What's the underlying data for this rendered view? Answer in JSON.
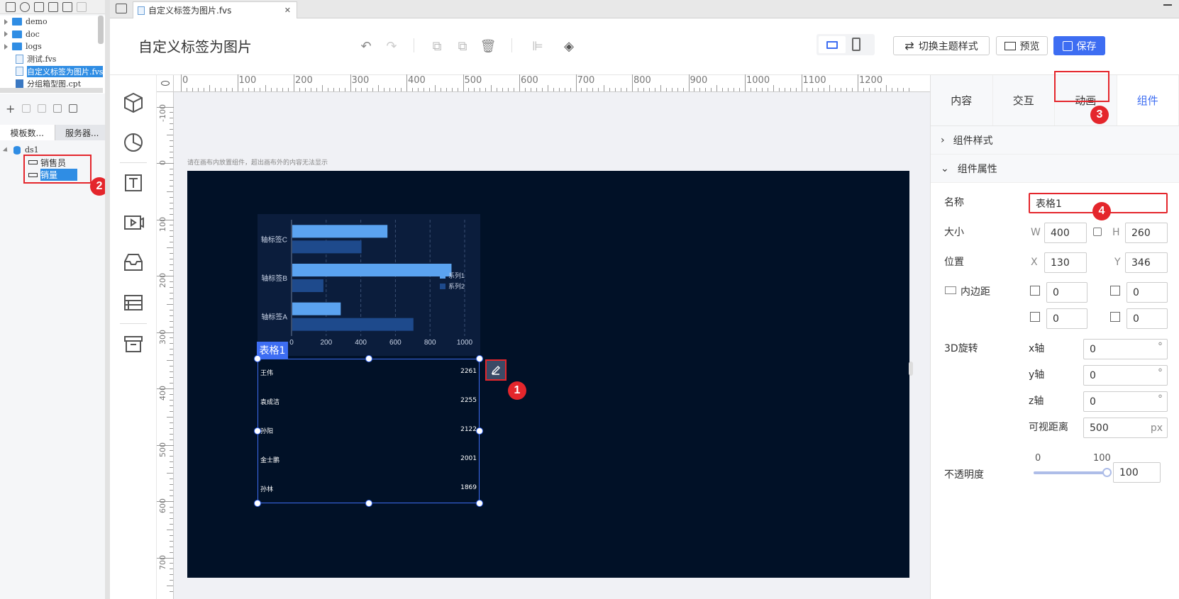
{
  "left_panel": {
    "tree": [
      "demo",
      "doc",
      "logs",
      "测试.fvs",
      "自定义标签为图片.fvs",
      "分组箱型图.cpt"
    ],
    "tabs": [
      "模板数...",
      "服务器..."
    ],
    "dataset": "ds1",
    "fields": [
      "销售员",
      "销量"
    ]
  },
  "tabbar": {
    "doc_tab": "自定义标签为图片.fvs",
    "close": "✕"
  },
  "header": {
    "title": "自定义标签为图片",
    "switch_theme": "切换主题样式",
    "preview": "预览",
    "save": "保存"
  },
  "ruler": {
    "top": [
      "0",
      "100",
      "200",
      "300",
      "400",
      "500",
      "600",
      "700",
      "800",
      "900",
      "1000",
      "1100",
      "1200"
    ],
    "left": [
      "-100",
      "0",
      "100",
      "200",
      "300",
      "400",
      "500",
      "600",
      "700"
    ]
  },
  "canvas": {
    "hint": "请在画布内放置组件，超出画布外的内容无法显示"
  },
  "chart_data": {
    "type": "bar",
    "categories": [
      "轴标签C",
      "轴标签B",
      "轴标签A"
    ],
    "series": [
      {
        "name": "系列1",
        "values": [
          550,
          920,
          280
        ]
      },
      {
        "name": "系列2",
        "values": [
          400,
          180,
          700
        ]
      }
    ],
    "xticks": [
      "0",
      "200",
      "400",
      "600",
      "800",
      "1000"
    ],
    "xlim": [
      0,
      1000
    ],
    "legend": "right"
  },
  "table_widget": {
    "label": "表格1",
    "rows": [
      {
        "name": "王伟",
        "value": "2261"
      },
      {
        "name": "袁成洁",
        "value": "2255"
      },
      {
        "name": "孙阳",
        "value": "2122"
      },
      {
        "name": "金士鹏",
        "value": "2001"
      },
      {
        "name": "孙林",
        "value": "1869"
      }
    ]
  },
  "right_panel": {
    "tabs": [
      "内容",
      "交互",
      "动画",
      "组件"
    ],
    "section_style": "组件样式",
    "section_props": "组件属性",
    "name_label": "名称",
    "name_value": "表格1",
    "size_label": "大小",
    "w_label": "W",
    "w_value": "400",
    "h_label": "H",
    "h_value": "260",
    "pos_label": "位置",
    "x_label": "X",
    "x_value": "130",
    "y_label": "Y",
    "y_value": "346",
    "padding_label": "内边距",
    "pad_top": "0",
    "pad_bottom": "0",
    "pad_left": "0",
    "pad_right": "0",
    "rot_label": "3D旋转",
    "x_axis": "x轴",
    "x_axis_value": "0",
    "y_axis": "y轴",
    "y_axis_value": "0",
    "z_axis": "z轴",
    "z_axis_value": "0",
    "degree": "°",
    "view_label": "可视距离",
    "view_value": "500",
    "view_unit": "px",
    "opacity_label": "不透明度",
    "opacity_min": "0",
    "opacity_max": "100",
    "opacity_value": "100",
    "opacity_level": 100
  },
  "badges": [
    "1",
    "2",
    "3",
    "4"
  ],
  "colors": {
    "accent": "#3d6df2",
    "save": "#3d6df2",
    "stage": "#011127",
    "series1": "#5ba3f0",
    "series2": "#1e4a8c",
    "red": "#e4262c"
  }
}
